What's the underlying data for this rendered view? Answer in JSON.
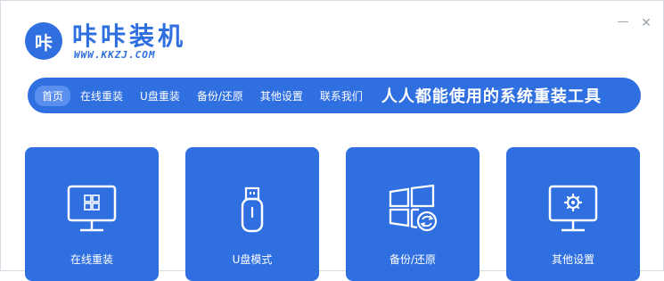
{
  "app": {
    "logo_text": "咔",
    "title": "咔咔装机",
    "url": "WWW.KKZJ.COM"
  },
  "window": {
    "minimize": "—",
    "close": "✕"
  },
  "nav": {
    "items": [
      {
        "label": "首页",
        "active": true
      },
      {
        "label": "在线重装"
      },
      {
        "label": "U盘重装"
      },
      {
        "label": "备份/还原"
      },
      {
        "label": "其他设置"
      },
      {
        "label": "联系我们"
      }
    ],
    "slogan": "人人都能使用的系统重装工具"
  },
  "cards": [
    {
      "label": "在线重装",
      "icon": "monitor-windows-icon"
    },
    {
      "label": "U盘模式",
      "icon": "usb-drive-icon"
    },
    {
      "label": "备份/还原",
      "icon": "windows-refresh-icon"
    },
    {
      "label": "其他设置",
      "icon": "monitor-gear-icon"
    }
  ],
  "colors": {
    "accent": "#2f6fe0",
    "nav_active": "#5a8ff0",
    "background": "#ffffff"
  }
}
